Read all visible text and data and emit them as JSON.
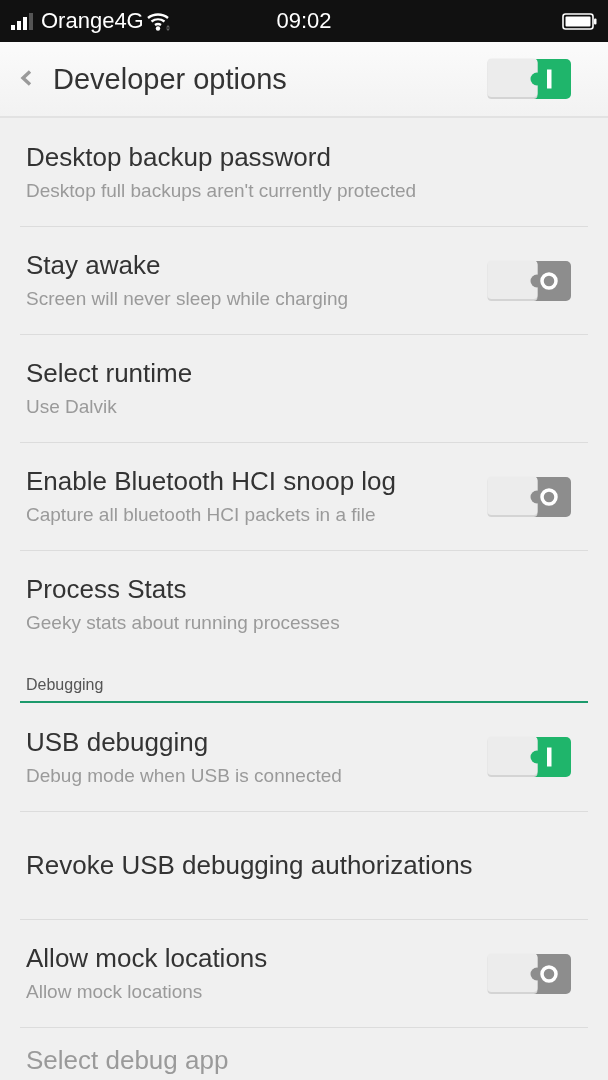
{
  "status_bar": {
    "carrier": "Orange4G",
    "time": "09:02"
  },
  "toolbar": {
    "title": "Developer options",
    "on": true
  },
  "sections": [
    {
      "items": [
        {
          "kind": "text",
          "title": "Desktop backup password",
          "subtitle": "Desktop full backups aren't currently protected"
        },
        {
          "kind": "switch",
          "title": "Stay awake",
          "subtitle": "Screen will never sleep while charging",
          "on": false
        },
        {
          "kind": "text",
          "title": "Select runtime",
          "subtitle": "Use Dalvik"
        },
        {
          "kind": "switch",
          "title": "Enable Bluetooth HCI snoop log",
          "subtitle": "Capture all bluetooth HCI packets in a file",
          "on": false
        },
        {
          "kind": "text",
          "title": "Process Stats",
          "subtitle": "Geeky stats about running processes"
        }
      ]
    },
    {
      "header": "Debugging",
      "items": [
        {
          "kind": "switch",
          "title": "USB debugging",
          "subtitle": "Debug mode when USB is connected",
          "on": true
        },
        {
          "kind": "text",
          "title": "Revoke USB debugging authorizations"
        },
        {
          "kind": "switch",
          "title": "Allow mock locations",
          "subtitle": "Allow mock locations",
          "on": false
        },
        {
          "kind": "text",
          "title": "Select debug app"
        }
      ]
    }
  ]
}
